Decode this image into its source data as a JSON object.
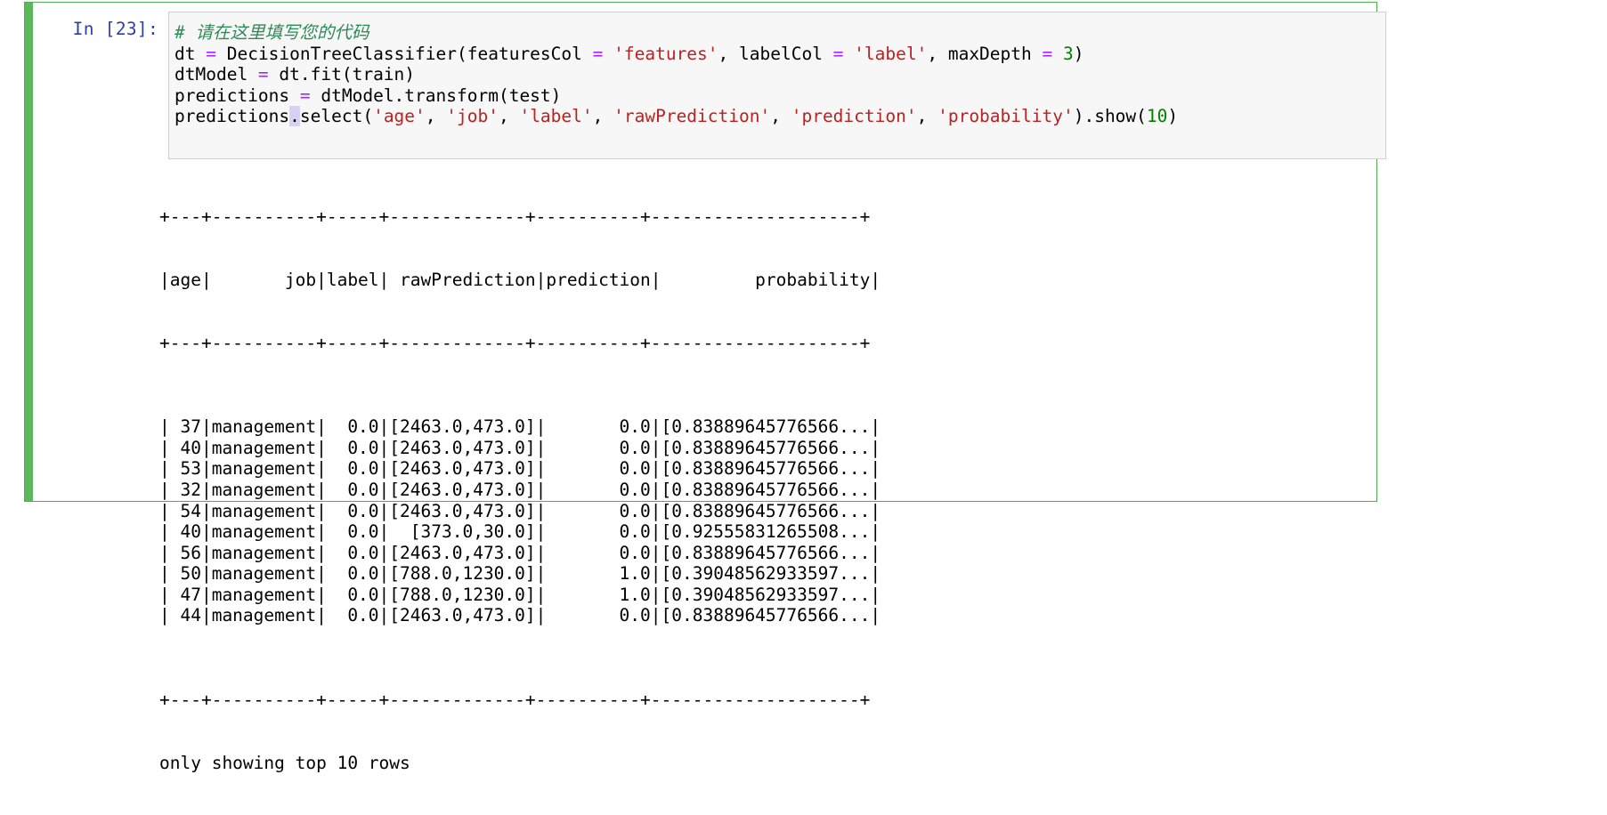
{
  "cell": {
    "prompt_label": "In [23]:",
    "execution_count": 23,
    "accent_color": "#5cb85c",
    "border_color": "#4caf50",
    "code_bg": "#f7f7f7"
  },
  "code": {
    "lines": [
      [
        {
          "t": "# 请在这里填写您的代码",
          "c": "comment"
        }
      ],
      [
        {
          "t": "dt ",
          "c": "plain"
        },
        {
          "t": "=",
          "c": "op"
        },
        {
          "t": " DecisionTreeClassifier(featuresCol ",
          "c": "plain"
        },
        {
          "t": "=",
          "c": "op"
        },
        {
          "t": " ",
          "c": "plain"
        },
        {
          "t": "'features'",
          "c": "str"
        },
        {
          "t": ", labelCol ",
          "c": "plain"
        },
        {
          "t": "=",
          "c": "op"
        },
        {
          "t": " ",
          "c": "plain"
        },
        {
          "t": "'label'",
          "c": "str"
        },
        {
          "t": ", maxDepth ",
          "c": "plain"
        },
        {
          "t": "=",
          "c": "op"
        },
        {
          "t": " ",
          "c": "plain"
        },
        {
          "t": "3",
          "c": "num"
        },
        {
          "t": ")",
          "c": "plain"
        }
      ],
      [
        {
          "t": "dtModel ",
          "c": "plain"
        },
        {
          "t": "=",
          "c": "op"
        },
        {
          "t": " dt.fit(train)",
          "c": "plain"
        }
      ],
      [
        {
          "t": "predictions ",
          "c": "plain"
        },
        {
          "t": "=",
          "c": "op"
        },
        {
          "t": " dtModel.transform(test)",
          "c": "plain"
        }
      ],
      [
        {
          "t": "predictions",
          "c": "plain"
        },
        {
          "t": ".",
          "c": "hl"
        },
        {
          "t": "select(",
          "c": "plain"
        },
        {
          "t": "'age'",
          "c": "str"
        },
        {
          "t": ", ",
          "c": "plain"
        },
        {
          "t": "'job'",
          "c": "str"
        },
        {
          "t": ", ",
          "c": "plain"
        },
        {
          "t": "'label'",
          "c": "str"
        },
        {
          "t": ", ",
          "c": "plain"
        },
        {
          "t": "'rawPrediction'",
          "c": "str"
        },
        {
          "t": ", ",
          "c": "plain"
        },
        {
          "t": "'prediction'",
          "c": "str"
        },
        {
          "t": ", ",
          "c": "plain"
        },
        {
          "t": "'probability'",
          "c": "str"
        },
        {
          "t": ").show(",
          "c": "plain"
        },
        {
          "t": "10",
          "c": "num"
        },
        {
          "t": ")",
          "c": "plain"
        }
      ]
    ]
  },
  "output": {
    "rule_top": "+---+----------+-----+-------------+----------+--------------------+",
    "header_line": "|age|       job|label| rawPrediction|prediction|         probability|",
    "rule_mid": "+---+----------+-----+-------------+----------+--------------------+",
    "rule_bottom": "+---+----------+-----+-------------+----------+--------------------+",
    "footer": "only showing top 10 rows",
    "columns": [
      "age",
      "job",
      "label",
      "rawPrediction",
      "prediction",
      "probability"
    ],
    "rows": [
      {
        "age": "37",
        "job": "management",
        "label": "0.0",
        "rawPrediction": "[2463.0,473.0]",
        "prediction": "0.0",
        "probability": "[0.83889645776566..."
      },
      {
        "age": "40",
        "job": "management",
        "label": "0.0",
        "rawPrediction": "[2463.0,473.0]",
        "prediction": "0.0",
        "probability": "[0.83889645776566..."
      },
      {
        "age": "53",
        "job": "management",
        "label": "0.0",
        "rawPrediction": "[2463.0,473.0]",
        "prediction": "0.0",
        "probability": "[0.83889645776566..."
      },
      {
        "age": "32",
        "job": "management",
        "label": "0.0",
        "rawPrediction": "[2463.0,473.0]",
        "prediction": "0.0",
        "probability": "[0.83889645776566..."
      },
      {
        "age": "54",
        "job": "management",
        "label": "0.0",
        "rawPrediction": "[2463.0,473.0]",
        "prediction": "0.0",
        "probability": "[0.83889645776566..."
      },
      {
        "age": "40",
        "job": "management",
        "label": "0.0",
        "rawPrediction": "[373.0,30.0]",
        "prediction": "0.0",
        "probability": "[0.92555831265508..."
      },
      {
        "age": "56",
        "job": "management",
        "label": "0.0",
        "rawPrediction": "[2463.0,473.0]",
        "prediction": "0.0",
        "probability": "[0.83889645776566..."
      },
      {
        "age": "50",
        "job": "management",
        "label": "0.0",
        "rawPrediction": "[788.0,1230.0]",
        "prediction": "1.0",
        "probability": "[0.39048562933597..."
      },
      {
        "age": "47",
        "job": "management",
        "label": "0.0",
        "rawPrediction": "[788.0,1230.0]",
        "prediction": "1.0",
        "probability": "[0.39048562933597..."
      },
      {
        "age": "44",
        "job": "management",
        "label": "0.0",
        "rawPrediction": "[2463.0,473.0]",
        "prediction": "0.0",
        "probability": "[0.83889645776566..."
      }
    ],
    "row_lines": [
      "| 37|management|  0.0|[2463.0,473.0]|       0.0|[0.83889645776566...|",
      "| 40|management|  0.0|[2463.0,473.0]|       0.0|[0.83889645776566...|",
      "| 53|management|  0.0|[2463.0,473.0]|       0.0|[0.83889645776566...|",
      "| 32|management|  0.0|[2463.0,473.0]|       0.0|[0.83889645776566...|",
      "| 54|management|  0.0|[2463.0,473.0]|       0.0|[0.83889645776566...|",
      "| 40|management|  0.0|  [373.0,30.0]|       0.0|[0.92555831265508...|",
      "| 56|management|  0.0|[2463.0,473.0]|       0.0|[0.83889645776566...|",
      "| 50|management|  0.0|[788.0,1230.0]|       1.0|[0.39048562933597...|",
      "| 47|management|  0.0|[788.0,1230.0]|       1.0|[0.39048562933597...|",
      "| 44|management|  0.0|[2463.0,473.0]|       0.0|[0.83889645776566...|"
    ]
  }
}
